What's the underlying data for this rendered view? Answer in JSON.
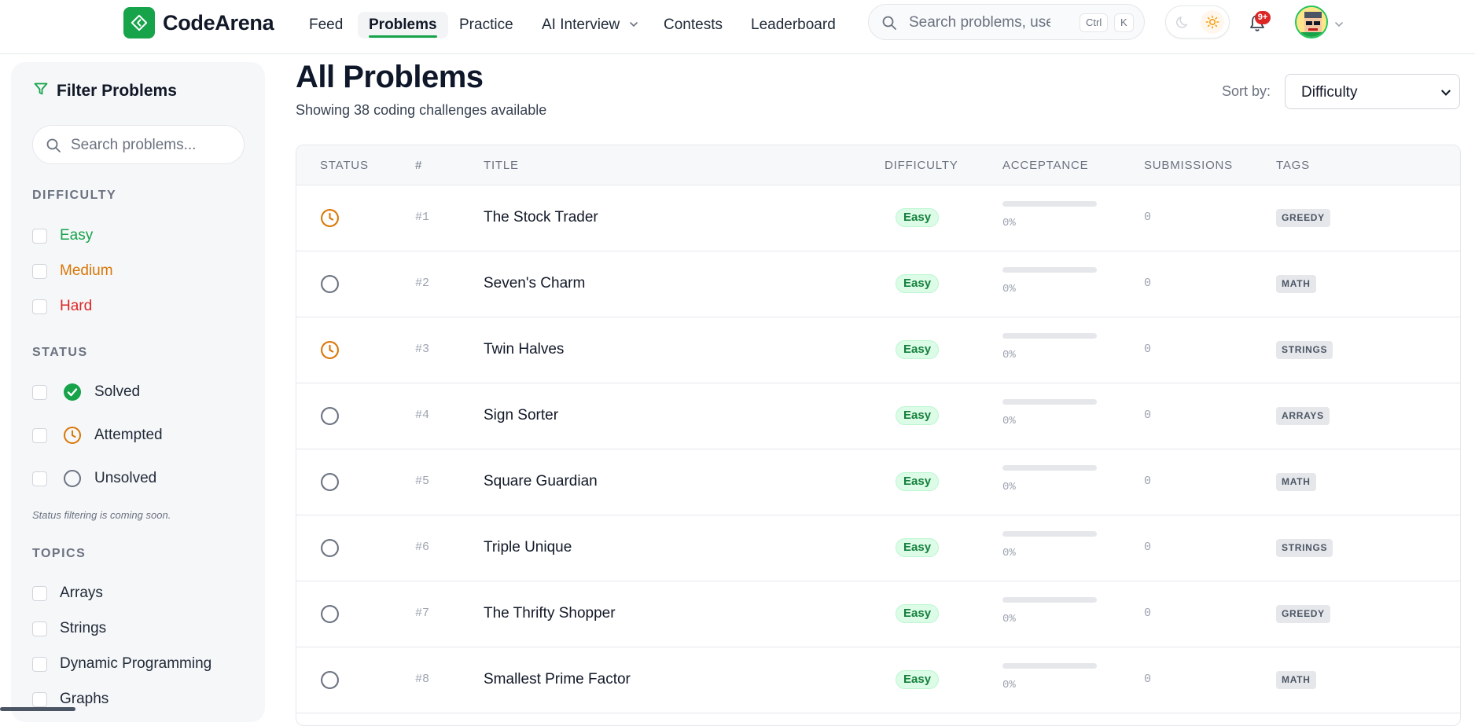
{
  "brand": {
    "name": "CodeArena",
    "accent": "#16a34a"
  },
  "nav": {
    "links": [
      {
        "label": "Feed"
      },
      {
        "label": "Problems",
        "active": true
      },
      {
        "label": "Practice"
      },
      {
        "label": "AI Interview",
        "dropdown": true
      },
      {
        "label": "Contests"
      },
      {
        "label": "Leaderboard"
      }
    ],
    "search": {
      "placeholder": "Search problems, users, companies...",
      "shortcut_mod": "Ctrl",
      "shortcut_key": "K"
    },
    "notifications": {
      "badge": "9+"
    },
    "icons": [
      "search-icon",
      "moon-icon",
      "sun-icon",
      "bell-icon",
      "chevron-down-icon"
    ]
  },
  "sidebar": {
    "title": "Filter Problems",
    "search_placeholder": "Search problems...",
    "difficulty": {
      "heading": "DIFFICULTY",
      "items": [
        {
          "label": "Easy",
          "color": "#16a34a"
        },
        {
          "label": "Medium",
          "color": "#d97706"
        },
        {
          "label": "Hard",
          "color": "#dc2626"
        }
      ]
    },
    "status": {
      "heading": "STATUS",
      "items": [
        {
          "label": "Solved",
          "icon": "check-circle-icon"
        },
        {
          "label": "Attempted",
          "icon": "clock-icon"
        },
        {
          "label": "Unsolved",
          "icon": "circle-icon"
        }
      ],
      "note": "Status filtering is coming soon."
    },
    "topics": {
      "heading": "TOPICS",
      "items": [
        {
          "label": "Arrays"
        },
        {
          "label": "Strings"
        },
        {
          "label": "Dynamic Programming"
        },
        {
          "label": "Graphs"
        }
      ]
    }
  },
  "main": {
    "title": "All Problems",
    "subtitle": "Showing 38 coding challenges available",
    "sort": {
      "label": "Sort by:",
      "value": "Difficulty"
    },
    "table": {
      "headers": [
        "STATUS",
        "#",
        "TITLE",
        "DIFFICULTY",
        "ACCEPTANCE",
        "SUBMISSIONS",
        "TAGS"
      ],
      "rows": [
        {
          "status": "attempted",
          "num": "#1",
          "title": "The Stock Trader",
          "difficulty": "Easy",
          "acceptance": "0%",
          "acceptance_value": 0,
          "submissions": "0",
          "tag": "GREEDY"
        },
        {
          "status": "unsolved",
          "num": "#2",
          "title": "Seven's Charm",
          "difficulty": "Easy",
          "acceptance": "0%",
          "acceptance_value": 0,
          "submissions": "0",
          "tag": "MATH"
        },
        {
          "status": "attempted",
          "num": "#3",
          "title": "Twin Halves",
          "difficulty": "Easy",
          "acceptance": "0%",
          "acceptance_value": 0,
          "submissions": "0",
          "tag": "STRINGS"
        },
        {
          "status": "unsolved",
          "num": "#4",
          "title": "Sign Sorter",
          "difficulty": "Easy",
          "acceptance": "0%",
          "acceptance_value": 0,
          "submissions": "0",
          "tag": "ARRAYS"
        },
        {
          "status": "unsolved",
          "num": "#5",
          "title": "Square Guardian",
          "difficulty": "Easy",
          "acceptance": "0%",
          "acceptance_value": 0,
          "submissions": "0",
          "tag": "MATH"
        },
        {
          "status": "unsolved",
          "num": "#6",
          "title": "Triple Unique",
          "difficulty": "Easy",
          "acceptance": "0%",
          "acceptance_value": 0,
          "submissions": "0",
          "tag": "STRINGS"
        },
        {
          "status": "unsolved",
          "num": "#7",
          "title": "The Thrifty Shopper",
          "difficulty": "Easy",
          "acceptance": "0%",
          "acceptance_value": 0,
          "submissions": "0",
          "tag": "GREEDY"
        },
        {
          "status": "unsolved",
          "num": "#8",
          "title": "Smallest Prime Factor",
          "difficulty": "Easy",
          "acceptance": "0%",
          "acceptance_value": 0,
          "submissions": "0",
          "tag": "MATH"
        }
      ]
    }
  }
}
